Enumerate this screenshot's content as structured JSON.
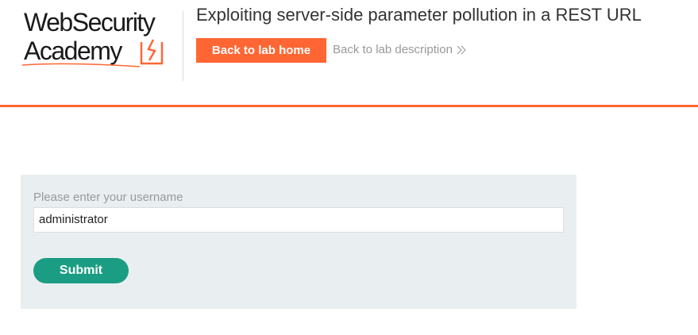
{
  "logo": {
    "line1": "WebSecurity",
    "line2": "Academy",
    "mark_icon": "lightning-bracket-icon",
    "brand_color": "#ff6633"
  },
  "header": {
    "title": "Exploiting server-side parameter pollution in a REST URL",
    "back_home_label": "Back to lab home",
    "back_description_label": "Back to lab description",
    "back_description_icon": "double-chevron-right-icon",
    "accent_color": "#ff6633"
  },
  "form": {
    "username_label": "Please enter your username",
    "username_value": "administrator",
    "submit_label": "Submit",
    "submit_color": "#1a9d83",
    "panel_color": "#e9eef1"
  }
}
